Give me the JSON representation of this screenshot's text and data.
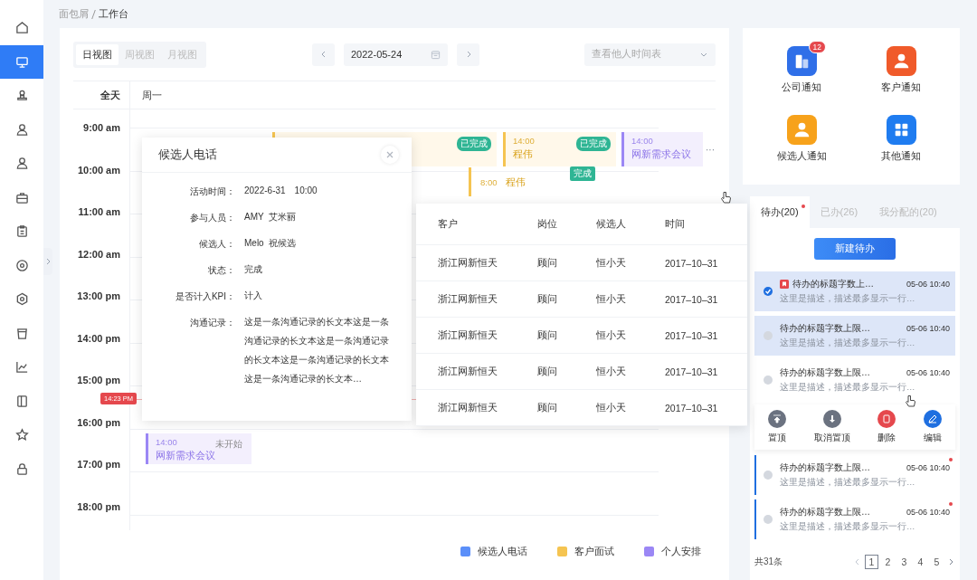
{
  "sidebar": {
    "items": [
      {
        "selected": false
      },
      {
        "selected": true
      },
      {
        "selected": false
      },
      {
        "selected": false
      },
      {
        "selected": false
      },
      {
        "selected": false
      },
      {
        "selected": false
      },
      {
        "selected": false
      },
      {
        "selected": false
      },
      {
        "selected": false
      },
      {
        "selected": false
      },
      {
        "selected": false
      },
      {
        "selected": false
      },
      {
        "selected": false
      }
    ]
  },
  "breadcrumb": [
    "面包屑",
    "工作台"
  ],
  "view_tabs": [
    {
      "label": "日视图",
      "selected": true
    },
    {
      "label": "周视图",
      "selected": false
    },
    {
      "label": "月视图",
      "selected": false
    }
  ],
  "date": "2022-05-24",
  "person_select": {
    "placeholder": "查看他人时间表"
  },
  "calendar": {
    "all_day": "全天",
    "day": "周一",
    "hours": [
      "9:00 am",
      "10:00 am",
      "11:00 am",
      "12:00 am",
      "13:00 pm",
      "14:00 pm",
      "15:00 pm",
      "16:00 pm",
      "17:00 pm",
      "18:00 pm"
    ],
    "now": "14:23 PM",
    "more": "···",
    "events": [
      {
        "kind": "interview",
        "tag": "已完成"
      },
      {
        "kind": "interview",
        "time": "14:00",
        "title": "程伟",
        "tag": "已完成"
      },
      {
        "kind": "personal",
        "time": "14:00",
        "title": "网新需求会议"
      },
      {
        "kind": "interview",
        "time": "8:00",
        "title": "程伟",
        "tag": "完成"
      },
      {
        "kind": "personal",
        "time": "14:00",
        "title": "网新需求会议",
        "status": "未开始"
      }
    ]
  },
  "legend": [
    {
      "label": "候选人电话",
      "color": "#5b8ff9"
    },
    {
      "label": "客户面试",
      "color": "#f5c451"
    },
    {
      "label": "个人安排",
      "color": "#9b87f5"
    }
  ],
  "popup": {
    "title": "候选人电话",
    "fields": [
      {
        "label": "活动时间：",
        "value": "2022-6-31　10:00"
      },
      {
        "label": "参与人员：",
        "value": "AMY  艾米丽"
      },
      {
        "label": "候选人：",
        "value": "Melo  祝候选"
      },
      {
        "label": "状态：",
        "value": "完成"
      },
      {
        "label": "是否计入KPI：",
        "value": "计入"
      },
      {
        "label": "沟通记录：",
        "value": "这是一条沟通记录的长文本这是一条沟通记录的长文本这是一条沟通记录的长文本这是一条沟通记录的长文本这是一条沟通记录的长文本…"
      }
    ]
  },
  "table": {
    "columns": [
      "客户",
      "岗位",
      "候选人",
      "时间"
    ],
    "rows": [
      [
        "浙江网新恒天",
        "顾问",
        "恒小天",
        "2017–10–31"
      ],
      [
        "浙江网新恒天",
        "顾问",
        "恒小天",
        "2017–10–31"
      ],
      [
        "浙江网新恒天",
        "顾问",
        "恒小天",
        "2017–10–31"
      ],
      [
        "浙江网新恒天",
        "顾问",
        "恒小天",
        "2017–10–31"
      ],
      [
        "浙江网新恒天",
        "顾问",
        "恒小天",
        "2017–10–31"
      ]
    ]
  },
  "notifications": [
    {
      "label": "公司通知",
      "badge": "12"
    },
    {
      "label": "客户通知"
    },
    {
      "label": "候选人通知"
    },
    {
      "label": "其他通知"
    }
  ],
  "todo_tabs": [
    {
      "label": "待办(20)",
      "selected": true,
      "dot": true
    },
    {
      "label": "已办(26)",
      "selected": false,
      "dot": false
    },
    {
      "label": "我分配的(20)",
      "selected": false,
      "dot": false
    }
  ],
  "new_todo": "新建待办",
  "todos": [
    {
      "title": "待办的标题字数上…",
      "desc": "这里是描述，描述最多显示一行…",
      "time": "05-06 10:40",
      "selected": true,
      "checked": true,
      "flagged": true,
      "accent": false,
      "unread": false
    },
    {
      "title": "待办的标题字数上限…",
      "desc": "这里是描述，描述最多显示一行…",
      "time": "05-06 10:40",
      "selected": true,
      "checked": false,
      "flagged": false,
      "accent": false,
      "unread": false
    },
    {
      "title": "待办的标题字数上限…",
      "desc": "这里是描述，描述最多显示一行…",
      "time": "05-06 10:40",
      "selected": false,
      "checked": false,
      "flagged": false,
      "accent": false,
      "unread": false
    },
    {
      "title": "待办的标题字数上限…",
      "desc": "这里是描述，描述最多显示一行…",
      "time": "05-06 10:40",
      "selected": false,
      "checked": false,
      "flagged": false,
      "accent": true,
      "unread": true
    },
    {
      "title": "待办的标题字数上限…",
      "desc": "这里是描述，描述最多显示一行…",
      "time": "05-06 10:40",
      "selected": false,
      "checked": false,
      "flagged": false,
      "accent": true,
      "unread": true
    }
  ],
  "todo_actions": [
    {
      "label": "置顶",
      "kind": "pin"
    },
    {
      "label": "取消置顶",
      "kind": "unpin"
    },
    {
      "label": "删除",
      "kind": "delete"
    },
    {
      "label": "编辑",
      "kind": "edit"
    }
  ],
  "pagination": {
    "total": "共31条",
    "pages": [
      {
        "label": "1",
        "selected": true
      },
      {
        "label": "2",
        "selected": false
      },
      {
        "label": "3",
        "selected": false
      },
      {
        "label": "4",
        "selected": false
      },
      {
        "label": "5",
        "selected": false
      }
    ]
  }
}
